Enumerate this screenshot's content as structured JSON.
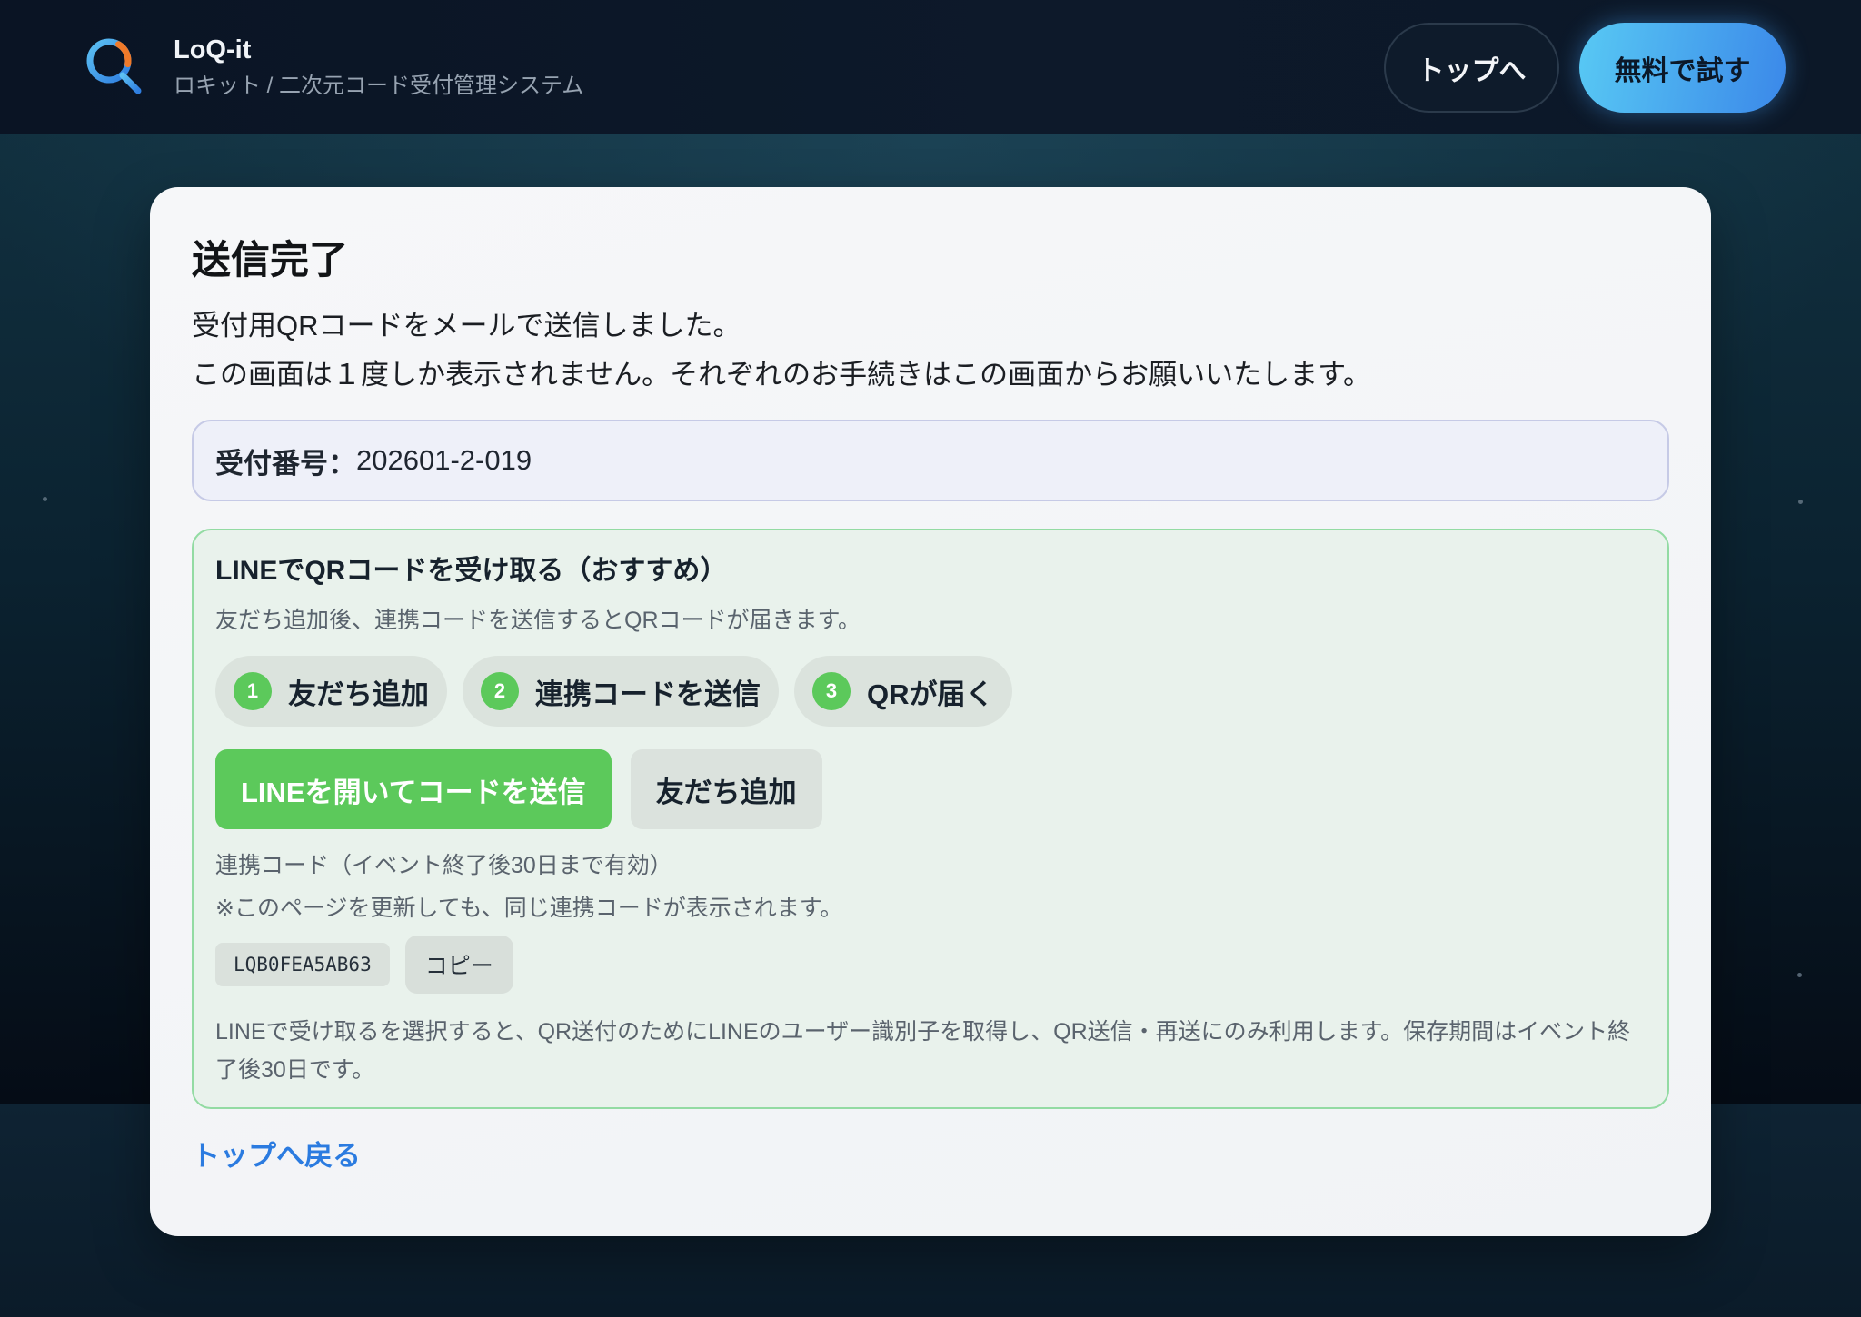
{
  "app": {
    "name": "LoQ-it",
    "subtitle": "ロキット / 二次元コード受付管理システム",
    "logo_icon": "magnifier-q-logo"
  },
  "header": {
    "top_button": "トップへ",
    "trial_button": "無料で試す"
  },
  "main": {
    "title": "送信完了",
    "message_lines": [
      "受付用QRコードをメールで送信しました。",
      "この画面は１度しか表示されません。それぞれのお手続きはこの画面からお願いいたします。"
    ],
    "receipt": {
      "label": "受付番号：",
      "value": "202601-2-019"
    },
    "line_section": {
      "title": "LINEでQRコードを受け取る（おすすめ）",
      "description": "友だち追加後、連携コードを送信するとQRコードが届きます。",
      "steps": [
        {
          "number": "1",
          "label": "友だち追加"
        },
        {
          "number": "2",
          "label": "連携コードを送信"
        },
        {
          "number": "3",
          "label": "QRが届く"
        }
      ],
      "open_line_button": "LINEを開いてコードを送信",
      "add_friend_button": "友だち追加",
      "code_note": "連携コード（イベント終了後30日まで有効）",
      "refresh_note": "※このページを更新しても、同じ連携コードが表示されます。",
      "code": "LQB0FEA5AB63",
      "copy_button": "コピー",
      "privacy_note": "LINEで受け取るを選択すると、QR送付のためにLINEのユーザー識別子を取得し、QR送信・再送にのみ利用します。保存期間はイベント終了後30日です。"
    },
    "back_link": "トップへ戻る"
  },
  "colors": {
    "line_green": "#5cc95b",
    "link_blue": "#2b7be0",
    "cta_start": "#58c9f4",
    "cta_end": "#3b88e9",
    "line_box_border": "#93dba3",
    "receipt_box_bg": "#eef0f9",
    "logo_blue": "#3a93e6",
    "logo_orange": "#f07a2a"
  }
}
